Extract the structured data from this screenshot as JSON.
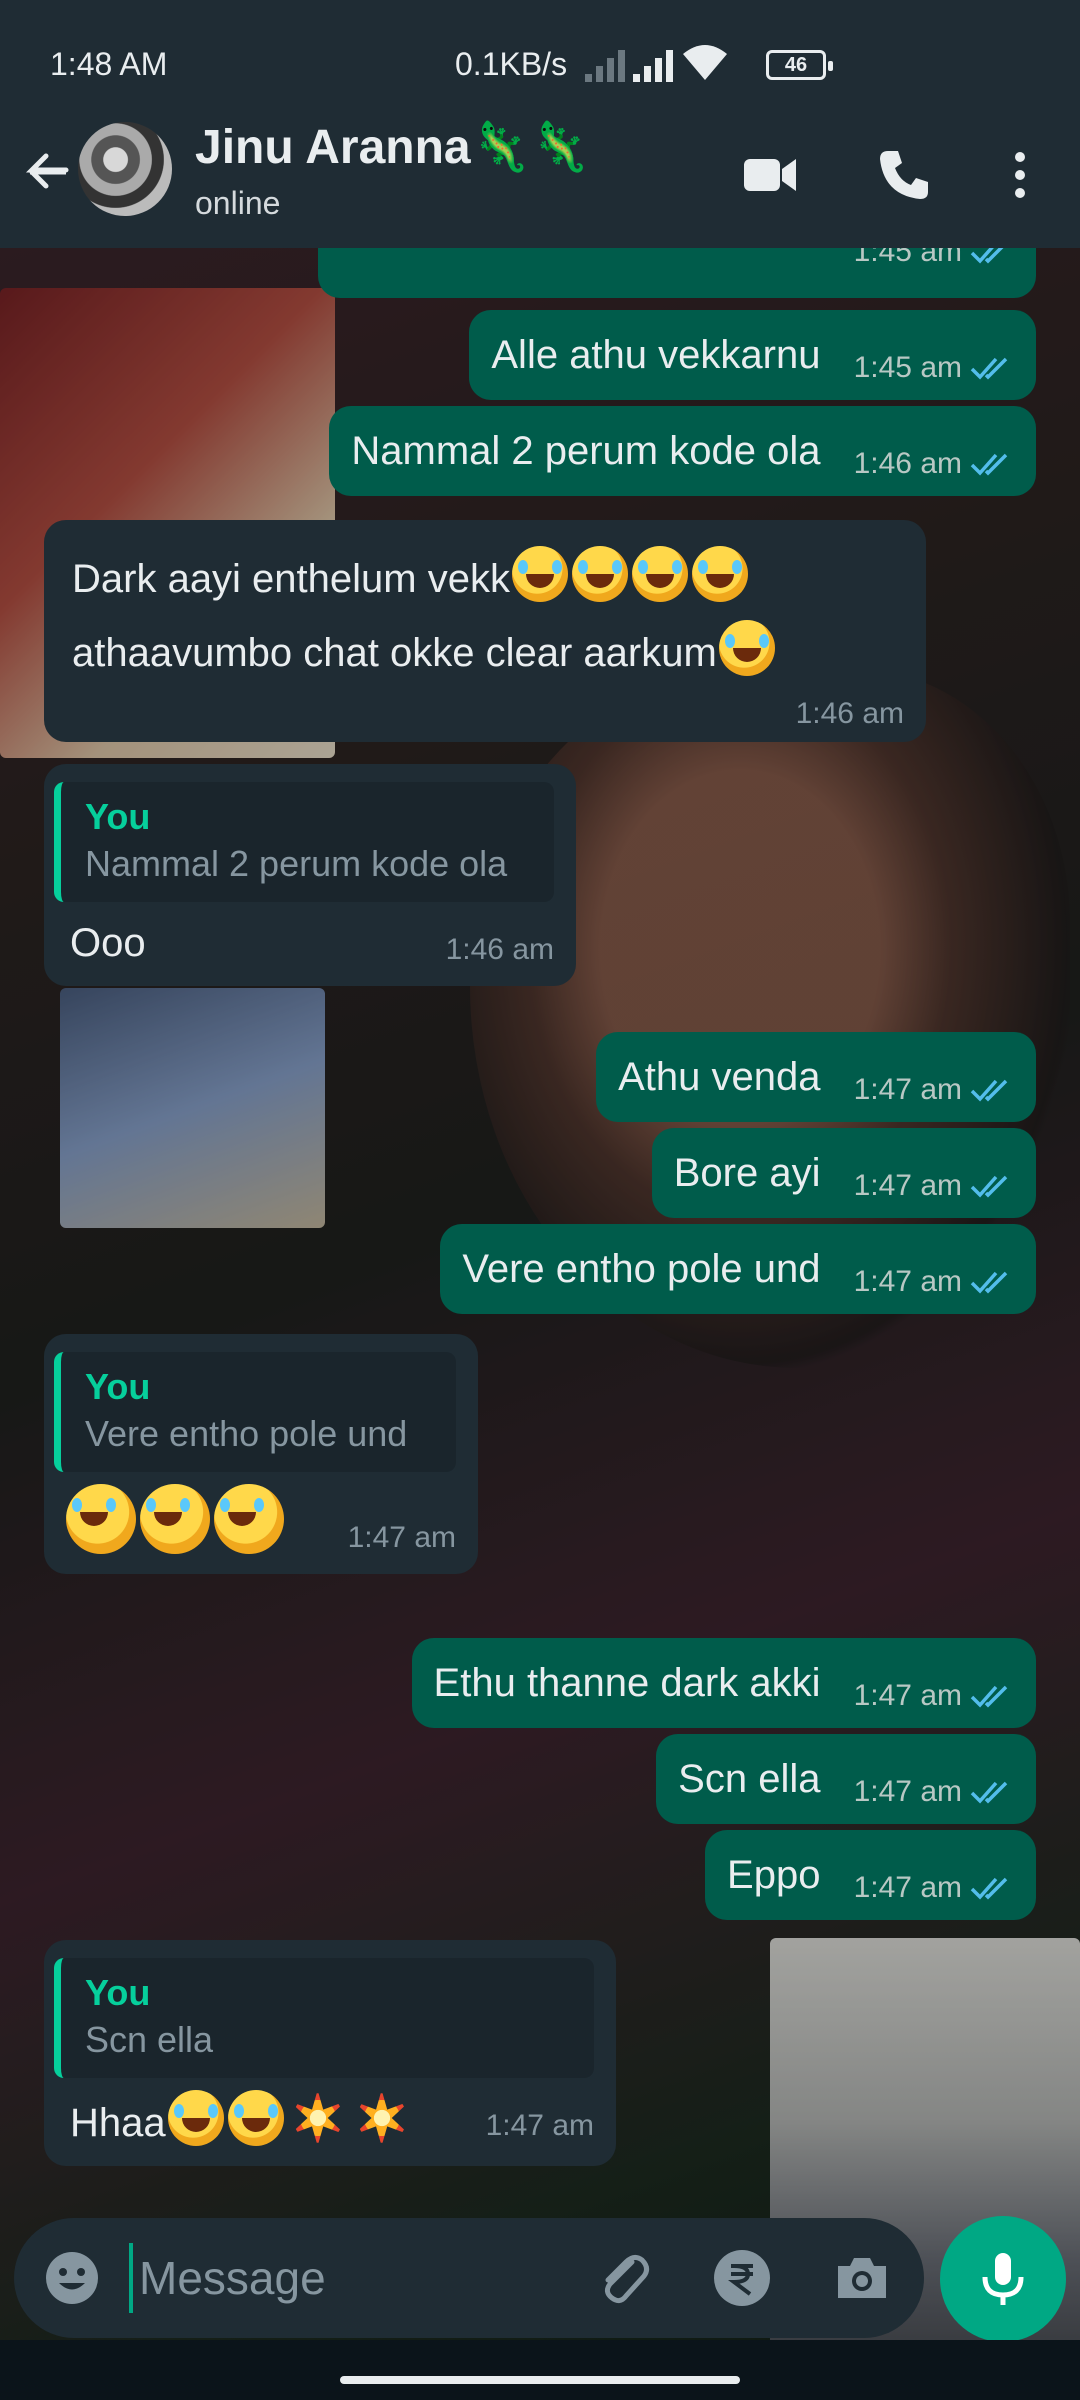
{
  "status_bar": {
    "time": "1:48 AM",
    "net_speed": "0.1KB/s",
    "battery": "46"
  },
  "header": {
    "contact_name": "Jinu Aranna🦎🦎",
    "status": "online"
  },
  "messages": [
    {
      "dir": "out",
      "text": "",
      "time": "1:45 am"
    },
    {
      "dir": "out",
      "text": "Alle athu vekkarnu",
      "time": "1:45 am"
    },
    {
      "dir": "out",
      "text": "Nammal 2 perum kode ola",
      "time": "1:46 am"
    },
    {
      "dir": "in",
      "text_line1": "Dark aayi enthelum vekk",
      "text_line2": "athaavumbo chat okke clear aarkum",
      "time": "1:46 am"
    },
    {
      "dir": "in",
      "quote_author": "You",
      "quote_text": "Nammal 2 perum kode ola",
      "text": "Ooo",
      "time": "1:46 am"
    },
    {
      "dir": "out",
      "text": "Athu venda",
      "time": "1:47 am"
    },
    {
      "dir": "out",
      "text": "Bore ayi",
      "time": "1:47 am"
    },
    {
      "dir": "out",
      "text": "Vere entho pole und",
      "time": "1:47 am"
    },
    {
      "dir": "in",
      "quote_author": "You",
      "quote_text": "Vere entho pole und",
      "text": "",
      "time": "1:47 am"
    },
    {
      "dir": "out",
      "text": "Ethu thanne dark akki",
      "time": "1:47 am"
    },
    {
      "dir": "out",
      "text": "Scn ella",
      "time": "1:47 am"
    },
    {
      "dir": "out",
      "text": "Eppo",
      "time": "1:47 am"
    },
    {
      "dir": "in",
      "quote_author": "You",
      "quote_text": "Scn ella",
      "text": "Hhaa",
      "time": "1:47 am"
    }
  ],
  "composer": {
    "placeholder": "Message"
  },
  "colors": {
    "outgoing_bubble": "#005c4b",
    "incoming_bubble": "#1f2c34",
    "accent": "#00a884",
    "read_ticks": "#53bdeb"
  }
}
